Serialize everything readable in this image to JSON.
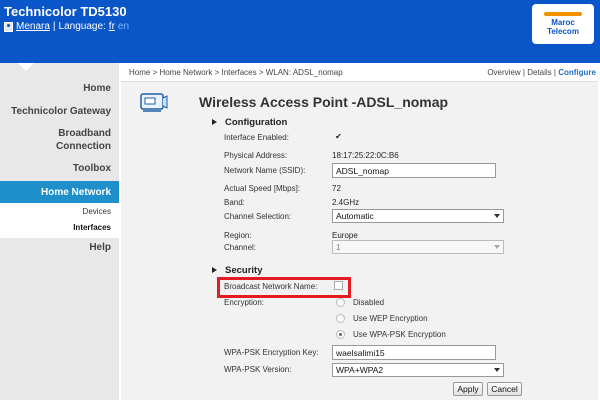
{
  "header": {
    "title": "Technicolor TD5130",
    "user": "Menara",
    "separator": "|",
    "language_label": "Language:",
    "lang_fr": "fr",
    "lang_en": "en",
    "logo_line1": "Maroc",
    "logo_line2": "Telecom"
  },
  "sidebar": {
    "items": [
      {
        "label": "Home"
      },
      {
        "label": "Technicolor Gateway"
      },
      {
        "label": "Broadband"
      },
      {
        "label": "Connection"
      },
      {
        "label": "Toolbox"
      },
      {
        "label": "Home Network"
      },
      {
        "label": "Help"
      }
    ],
    "subitems": [
      {
        "label": "Devices"
      },
      {
        "label": "Interfaces"
      }
    ]
  },
  "breadcrumb": "Home > Home Network > Interfaces > WLAN: ADSL_nomap",
  "viewlinks": {
    "overview": "Overview",
    "sep1": "|",
    "details": "Details",
    "sep2": "|",
    "configure": "Configure"
  },
  "page_title": "Wireless Access Point -ADSL_nomap",
  "configuration": {
    "section_title": "Configuration",
    "interface_enabled_label": "Interface Enabled:",
    "interface_enabled_check": "✔",
    "physical_address_label": "Physical Address:",
    "physical_address": "18:17:25:22:0C:B6",
    "ssid_label": "Network Name (SSID):",
    "ssid_value": "ADSL_nomap",
    "actual_speed_label": "Actual Speed [Mbps]:",
    "actual_speed": "72",
    "band_label": "Band:",
    "band": "2.4GHz",
    "channel_selection_label": "Channel Selection:",
    "channel_selection": "Automatic",
    "region_label": "Region:",
    "region": "Europe",
    "channel_label": "Channel:",
    "channel": "1"
  },
  "security": {
    "section_title": "Security",
    "broadcast_label": "Broadcast Network Name:",
    "encryption_label": "Encryption:",
    "enc_options": [
      {
        "label": "Disabled"
      },
      {
        "label": "Use WEP Encryption"
      },
      {
        "label": "Use WPA-PSK Encryption"
      }
    ],
    "key_label": "WPA-PSK Encryption Key:",
    "key_value": "waelsalimi15",
    "version_label": "WPA-PSK Version:",
    "version_value": "WPA+WPA2"
  },
  "buttons": {
    "apply": "Apply",
    "cancel": "Cancel"
  },
  "colors": {
    "header": "#0a56c8",
    "nav_active": "#1f8fcc",
    "highlight": "#e41b23"
  }
}
